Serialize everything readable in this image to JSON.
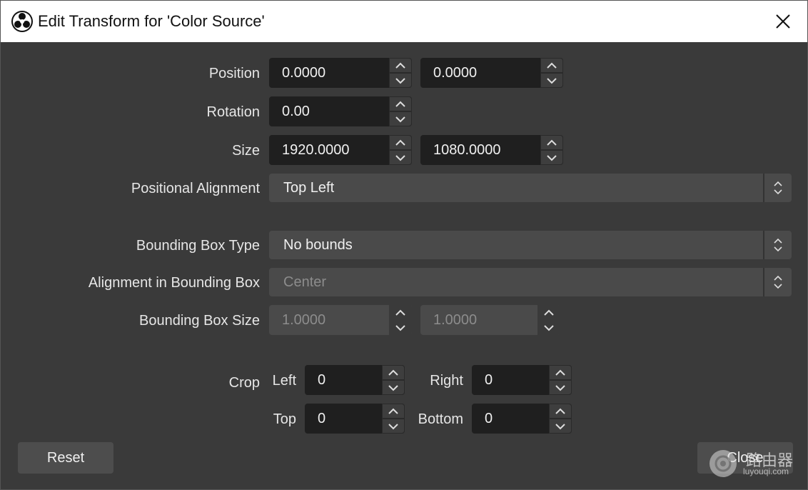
{
  "window": {
    "title": "Edit Transform for 'Color Source'"
  },
  "position": {
    "label": "Position",
    "x": "0.0000",
    "y": "0.0000"
  },
  "rotation": {
    "label": "Rotation",
    "value": "0.00"
  },
  "size": {
    "label": "Size",
    "width": "1920.0000",
    "height": "1080.0000"
  },
  "positional_alignment": {
    "label": "Positional Alignment",
    "value": "Top Left"
  },
  "bounding_box_type": {
    "label": "Bounding Box Type",
    "value": "No bounds"
  },
  "alignment_in_bounding_box": {
    "label": "Alignment in Bounding Box",
    "value": "Center"
  },
  "bounding_box_size": {
    "label": "Bounding Box Size",
    "width": "1.0000",
    "height": "1.0000"
  },
  "crop": {
    "label": "Crop",
    "left_label": "Left",
    "left": "0",
    "right_label": "Right",
    "right": "0",
    "top_label": "Top",
    "top": "0",
    "bottom_label": "Bottom",
    "bottom": "0"
  },
  "buttons": {
    "reset": "Reset",
    "close": "Close"
  },
  "watermark": {
    "text": "路由器",
    "url": "luyouqi.com"
  },
  "icons": {
    "app": "obs-logo-icon",
    "close": "close-icon",
    "up": "chevron-up-icon",
    "down": "chevron-down-icon",
    "updown": "updown-chevron-icon"
  }
}
